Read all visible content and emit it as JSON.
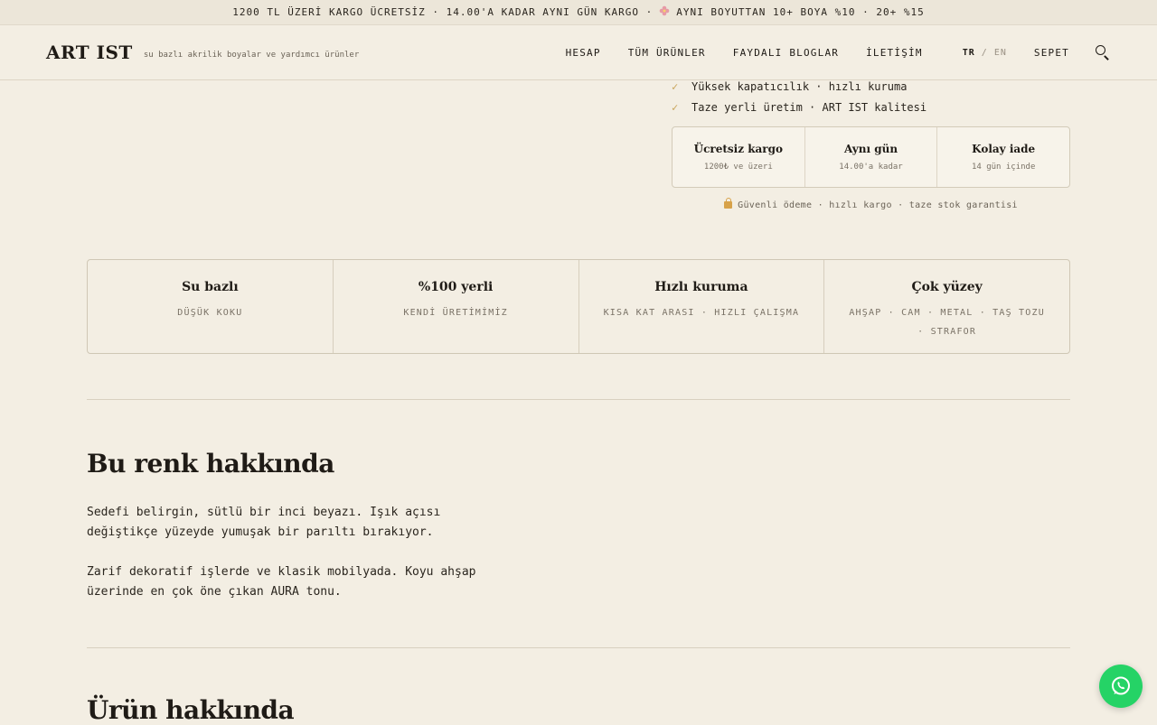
{
  "announcement": {
    "part1": "1200 TL ÜZERİ KARGO ÜCRETSİZ · 14.00'A KADAR AYNI GÜN KARGO ·",
    "part2": "AYNI BOYUTTAN 10+ BOYA %10 · 20+ %15"
  },
  "header": {
    "logo": "ART IST",
    "tagline": "su bazlı akrilik boyalar ve yardımcı ürünler",
    "nav": [
      "HESAP",
      "TÜM ÜRÜNLER",
      "FAYDALI BLOGLAR",
      "İLETİŞİM"
    ],
    "lang_active": "TR",
    "lang_sep": "/",
    "lang_other": "EN",
    "cart": "SEPET"
  },
  "checks": [
    "Yüksek kapatıcılık · hızlı kuruma",
    "Taze yerli üretim · ART IST kalitesi"
  ],
  "perks": [
    {
      "title": "Ücretsiz kargo",
      "sub": "1200₺ ve üzeri"
    },
    {
      "title": "Aynı gün",
      "sub": "14.00'a kadar"
    },
    {
      "title": "Kolay iade",
      "sub": "14 gün içinde"
    }
  ],
  "secure_text": "Güvenli ödeme · hızlı kargo · taze stok garantisi",
  "features": [
    {
      "title": "Su bazlı",
      "sub": "DÜŞÜK KOKU"
    },
    {
      "title": "%100 yerli",
      "sub": "KENDİ ÜRETİMİMİZ"
    },
    {
      "title": "Hızlı kuruma",
      "sub": "KISA KAT ARASI · HIZLI ÇALIŞMA"
    },
    {
      "title": "Çok yüzey",
      "sub": "AHŞAP · CAM · METAL · TAŞ TOZU · STRAFOR"
    }
  ],
  "about": {
    "title": "Bu renk hakkında",
    "p1": "Sedefi belirgin, sütlü bir inci beyazı. Işık açısı değiştikçe yüzeyde yumuşak bir parıltı bırakıyor.",
    "p2": "Zarif dekoratif işlerde ve klasik mobilyada. Koyu ahşap üzerinde en çok öne çıkan AURA tonu."
  },
  "product": {
    "title": "Ürün hakkında"
  },
  "colors": {
    "accent": "#c9a45a",
    "whatsapp": "#25d366",
    "background": "#f3eee3"
  },
  "icons": {
    "announce": "flower-icon",
    "lock": "lock-icon",
    "search": "search-icon",
    "whatsapp": "whatsapp-icon"
  }
}
